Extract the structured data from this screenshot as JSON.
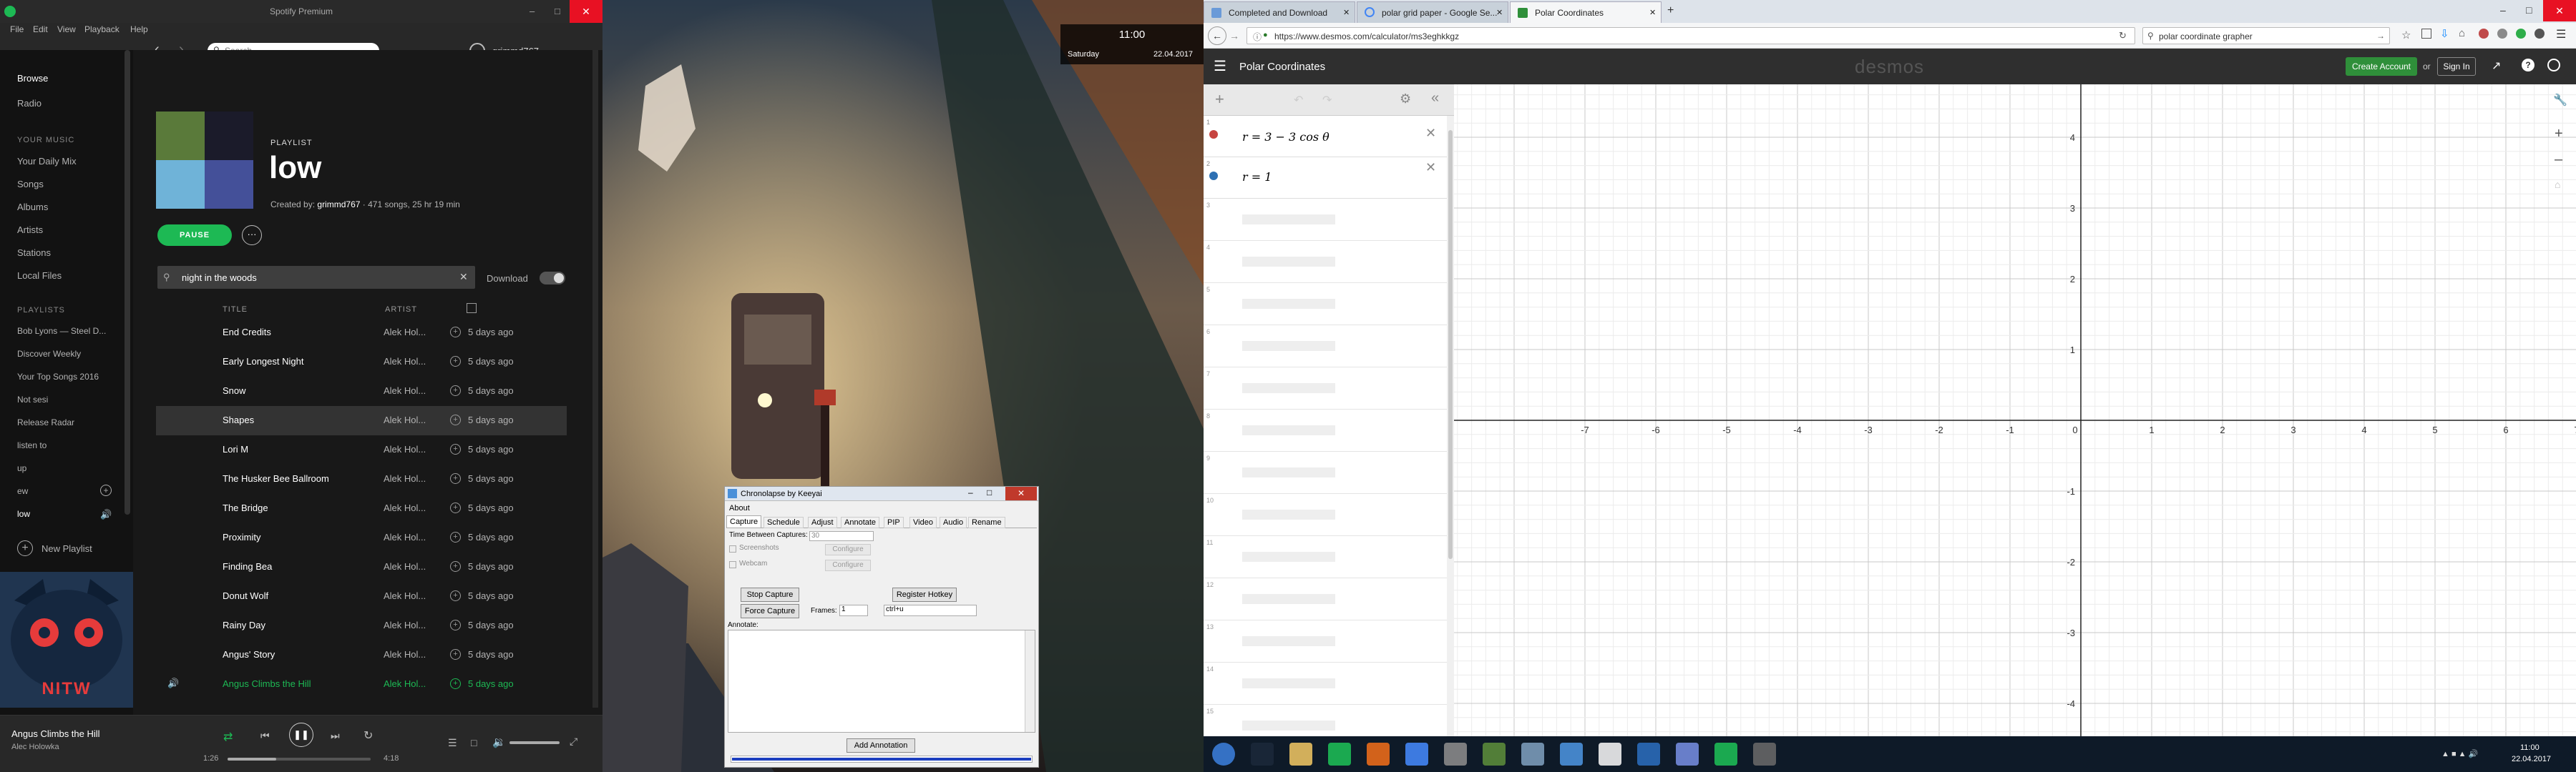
{
  "spotify": {
    "window_title": "Spotify Premium",
    "menu": [
      "File",
      "Edit",
      "View",
      "Playback",
      "Help"
    ],
    "search_placeholder": "Search",
    "username": "grimmd767",
    "sidebar": {
      "browse": "Browse",
      "radio": "Radio",
      "library_header": "YOUR MUSIC",
      "library": [
        "Your Daily Mix",
        "Songs",
        "Albums",
        "Artists",
        "Stations",
        "Local Files"
      ],
      "playlists_header": "PLAYLISTS",
      "playlists": [
        "Bob Lyons — Steel D...",
        "Discover Weekly",
        "Your Top Songs 2016",
        "Not sesi",
        "Release Radar",
        "listen to",
        "up",
        "ew",
        "low"
      ],
      "new_playlist": "New Playlist",
      "album_art_text": "NITW"
    },
    "playlist": {
      "type_label": "PLAYLIST",
      "name": "low",
      "created_by_prefix": "Created by:",
      "creator": "grimmd767",
      "meta": "· 471 songs, 25 hr 19 min",
      "pause_label": "PAUSE",
      "more_label": "···",
      "filter_value": "night in the woods",
      "download_label": "Download"
    },
    "columns": {
      "title": "TITLE",
      "artist": "ARTIST"
    },
    "tracks": [
      {
        "title": "End Credits",
        "artist": "Alek Hol...",
        "date": "5 days ago"
      },
      {
        "title": "Early Longest Night",
        "artist": "Alek Hol...",
        "date": "5 days ago"
      },
      {
        "title": "Snow",
        "artist": "Alek Hol...",
        "date": "5 days ago"
      },
      {
        "title": "Shapes",
        "artist": "Alek Hol...",
        "date": "5 days ago"
      },
      {
        "title": "Lori M",
        "artist": "Alek Hol...",
        "date": "5 days ago"
      },
      {
        "title": "The Husker Bee Ballroom",
        "artist": "Alek Hol...",
        "date": "5 days ago"
      },
      {
        "title": "The Bridge",
        "artist": "Alek Hol...",
        "date": "5 days ago"
      },
      {
        "title": "Proximity",
        "artist": "Alek Hol...",
        "date": "5 days ago"
      },
      {
        "title": "Finding Bea",
        "artist": "Alek Hol...",
        "date": "5 days ago"
      },
      {
        "title": "Donut Wolf",
        "artist": "Alek Hol...",
        "date": "5 days ago"
      },
      {
        "title": "Rainy Day",
        "artist": "Alek Hol...",
        "date": "5 days ago"
      },
      {
        "title": "Angus' Story",
        "artist": "Alek Hol...",
        "date": "5 days ago"
      },
      {
        "title": "Angus Climbs the Hill",
        "artist": "Alek Hol...",
        "date": "5 days ago"
      }
    ],
    "now_playing": {
      "title": "Angus Climbs the Hill",
      "artist": "Alec Holowka",
      "time_elapsed": "1:26",
      "time_total": "4:18",
      "progress_fraction": 0.34
    },
    "colors": {
      "accent": "#1db954",
      "bg": "#181818",
      "sidebar": "#121212"
    }
  },
  "clock": {
    "time": "11:00",
    "day": "Saturday",
    "date": "22.04.2017"
  },
  "chronolapse": {
    "title": "Chronolapse by Keeyai",
    "about": "About",
    "tabs": [
      "Capture",
      "Schedule",
      "Adjust",
      "Annotate",
      "PIP",
      "Video",
      "Audio",
      "Rename"
    ],
    "time_between_label": "Time Between Captures:",
    "time_between_value": "30",
    "screenshots_label": "Screenshots",
    "webcam_label": "Webcam",
    "configure_label": "Configure",
    "stop_capture": "Stop Capture",
    "force_capture": "Force Capture",
    "frames_label": "Frames:",
    "frames_value": "1",
    "register_hotkey": "Register Hotkey",
    "hotkey_value": "ctrl+u",
    "annotate_label": "Annotate:",
    "add_annotation": "Add Annotation"
  },
  "browser": {
    "tabs": [
      "Completed and Download",
      "polar grid paper - Google Se...",
      "Polar Coordinates"
    ],
    "url": "https://www.desmos.com/calculator/ms3eghkkgz",
    "search_value": "polar coordinate grapher"
  },
  "desmos": {
    "title": "Polar Coordinates",
    "logo": "desmos",
    "create_account": "Create Account",
    "or": "or",
    "sign_in": "Sign In",
    "expressions": [
      {
        "num": "1",
        "latex": "r = 3 − 3 cos θ"
      },
      {
        "num": "2",
        "latex": "r = 1"
      }
    ],
    "empty_rows": [
      "3",
      "4",
      "5",
      "6",
      "7",
      "8",
      "9",
      "10",
      "11",
      "12",
      "13",
      "14",
      "15"
    ],
    "x_ticks": [
      "-7",
      "-6",
      "-5",
      "-4",
      "-3",
      "-2",
      "-1",
      "0",
      "1",
      "2",
      "3",
      "4",
      "5",
      "6",
      "7"
    ],
    "y_ticks": [
      "4",
      "3",
      "2",
      "1",
      "-1",
      "-2",
      "-3",
      "-4"
    ],
    "colors": {
      "green": "#2f8f3a",
      "header": "#2f2f2f",
      "blue": "#2d70b3"
    }
  },
  "taskbar": {
    "icons": [
      "start-orb",
      "steam-icon",
      "explorer-icon",
      "spotify-icon",
      "firefox-icon",
      "chrome-icon",
      "app-icon",
      "minecraft-icon",
      "files-icon",
      "app2-icon",
      "app3-icon",
      "app4-icon",
      "discord-icon",
      "chronolapse-icon",
      "app5-icon"
    ],
    "time": "11:00",
    "date": "22.04.2017"
  }
}
